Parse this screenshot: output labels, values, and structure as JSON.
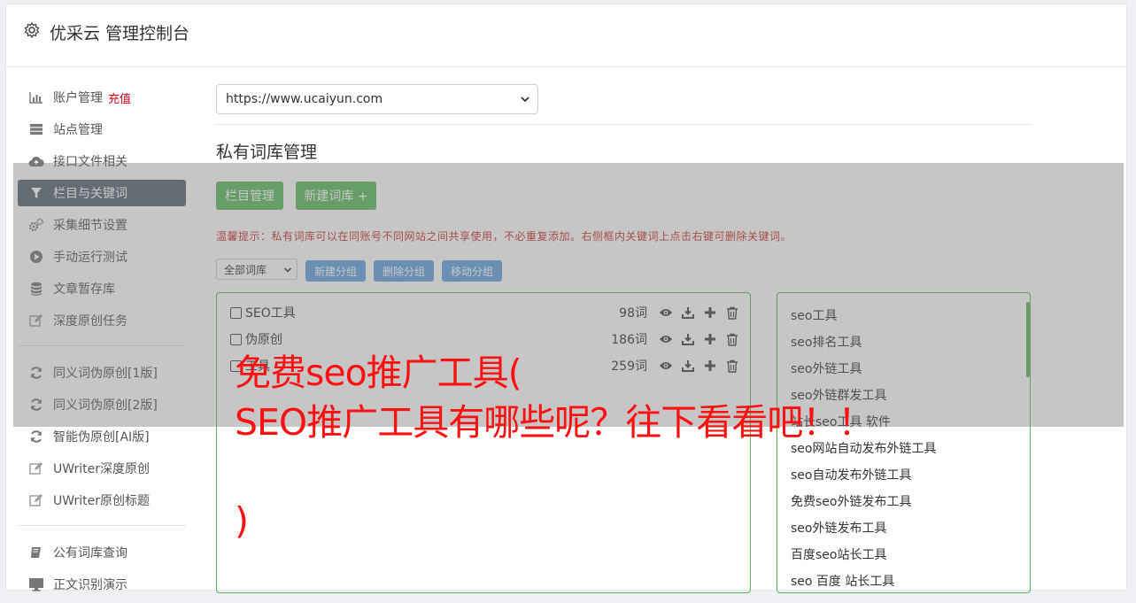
{
  "header": {
    "title": "优采云 管理控制台",
    "icon": "gear-icon"
  },
  "sidebar": {
    "items": [
      {
        "label": "账户管理",
        "badge": "充值",
        "icon": "bar-chart-icon"
      },
      {
        "label": "站点管理",
        "icon": "server-icon"
      },
      {
        "label": "接口文件相关",
        "icon": "cloud-upload-icon"
      },
      {
        "label": "栏目与关键词",
        "icon": "filter-icon",
        "active": true
      },
      {
        "label": "采集细节设置",
        "icon": "gears-icon"
      },
      {
        "label": "手动运行测试",
        "icon": "play-circle-icon"
      },
      {
        "label": "文章暂存库",
        "icon": "database-icon"
      },
      {
        "label": "深度原创任务",
        "icon": "edit-icon"
      }
    ],
    "items2": [
      {
        "label": "同义词伪原创[1版]",
        "icon": "refresh-icon"
      },
      {
        "label": "同义词伪原创[2版]",
        "icon": "refresh-icon"
      },
      {
        "label": "智能伪原创[AI版]",
        "icon": "refresh-icon"
      },
      {
        "label": "UWriter深度原创",
        "icon": "edit-icon"
      },
      {
        "label": "UWriter原创标题",
        "icon": "edit-icon"
      }
    ],
    "items3": [
      {
        "label": "公有词库查询",
        "icon": "book-icon"
      },
      {
        "label": "正文识别演示",
        "icon": "monitor-icon"
      }
    ]
  },
  "main": {
    "site_url": "https://www.ucaiyun.com",
    "section_title": "私有词库管理",
    "btn_columns": "栏目管理",
    "btn_new_lib": "新建词库 +",
    "tip": "温馨提示：私有词库可以在同账号不同网站之间共享使用，不必重复添加。右侧框内关键词上点击右键可删除关键词。",
    "group_select": "全部词库",
    "btn_new_group": "新建分组",
    "btn_del_group": "删除分组",
    "btn_move_group": "移动分组",
    "libraries": [
      {
        "name": "SEO工具",
        "count": "98词"
      },
      {
        "name": "伪原创",
        "count": "186词"
      },
      {
        "name": "工具",
        "count": "259词"
      }
    ],
    "keywords": [
      "seo工具",
      "seo排名工具",
      "seo外链工具",
      "seo外链群发工具",
      "站长seo工具 软件",
      "seo网站自动发布外链工具",
      "seo自动发布外链工具",
      "免费seo外链发布工具",
      "seo外链发布工具",
      "百度seo站长工具",
      "seo 百度 站长工具"
    ]
  },
  "overlay": {
    "line1": "免费seo推广工具(",
    "line2": "SEO推广工具有哪些呢？往下看看吧！！",
    "line3": ")"
  }
}
